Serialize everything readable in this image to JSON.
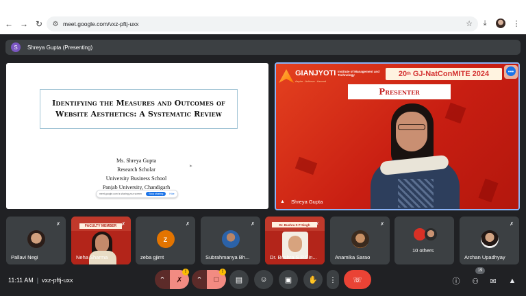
{
  "browser": {
    "url": "meet.google.com/vxz-pftj-uxx"
  },
  "presenting": {
    "avatar_letter": "S",
    "label": "Shreya Gupta (Presenting)"
  },
  "slide": {
    "title": "Identifying the Measures and Outcomes of Website Aesthetics: A Systematic Review",
    "author_lines": [
      "Ms. Shreya Gupta",
      "Research Scholar",
      "University Business School",
      "Panjab University, Chandigarh"
    ],
    "share_bar": {
      "text": "meet.google.com is sharing your screen",
      "stop_label": "Stop sharing",
      "hide_label": "Hide"
    }
  },
  "presenter_video": {
    "logo_name": "GIANJYOTI",
    "logo_institute": "Institute of Management and Technology",
    "logo_tagline": "Aspire . Achieve . Ascend",
    "conference_prefix": "20",
    "conference_suffix": "th",
    "conference_name": "GJ-NatConMITE 2024",
    "banner": "Presenter",
    "name": "Shreya Gupta"
  },
  "participants": [
    {
      "name": "Pallavi Negi",
      "kind": "photo",
      "muted": true
    },
    {
      "name": "Neha Sharma",
      "kind": "video",
      "muted": true,
      "banner": "FACULTY MEMBER"
    },
    {
      "name": "zeba gjimt",
      "kind": "letter",
      "letter": "z",
      "muted": true
    },
    {
      "name": "Subrahmanya Bh...",
      "kind": "photo",
      "muted": true
    },
    {
      "name": "Dr. Bushra S P Sin...",
      "kind": "video",
      "muted": true,
      "banner": "Dr. Bushra S P Singh"
    },
    {
      "name": "Anamika Sarao",
      "kind": "photo",
      "muted": true
    },
    {
      "name": "10 others",
      "kind": "group",
      "muted": false
    },
    {
      "name": "Archan Upadhyay",
      "kind": "photo",
      "muted": true
    }
  ],
  "controls": {
    "time": "11:11 AM",
    "separator": "|",
    "meeting_code": "vxz-pftj-uxx",
    "mic_badge": "!",
    "cam_badge": "!",
    "people_count": "19"
  },
  "colors": {
    "meet_bg": "#202124",
    "tile_bg": "#3c4043",
    "accent": "#8ab4f8",
    "end_call": "#ea4335",
    "warn": "#f28b82"
  }
}
